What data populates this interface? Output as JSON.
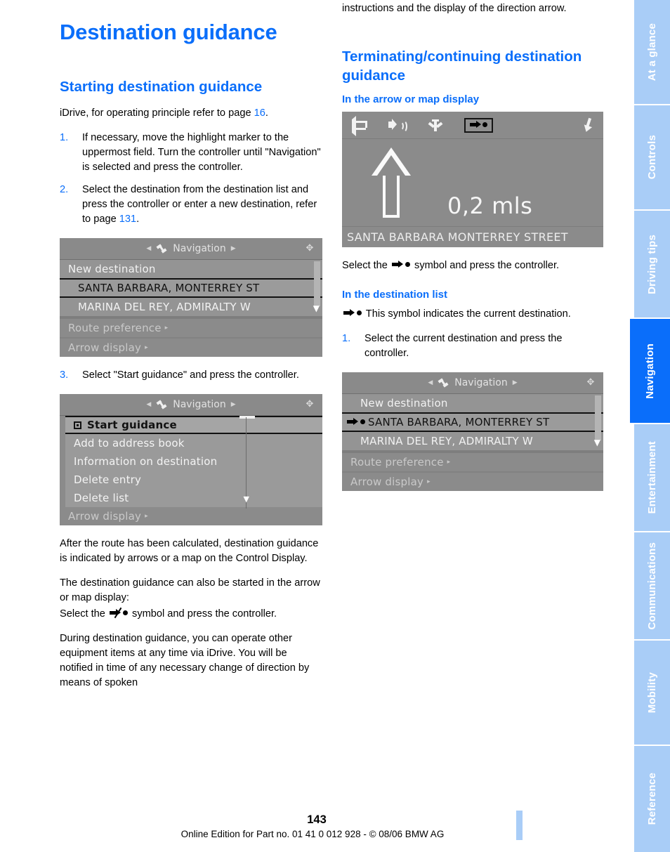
{
  "document": {
    "title": "Destination guidance",
    "page_number": "143",
    "footer_line": "Online Edition for Part no. 01 41 0 012 928 - © 08/06 BMW AG",
    "accent_color": "#0a6efa",
    "tab_inactive_color": "#a9cdf7"
  },
  "sidebar": {
    "tabs": [
      {
        "label": "At a glance",
        "active": false
      },
      {
        "label": "Controls",
        "active": false
      },
      {
        "label": "Driving tips",
        "active": false
      },
      {
        "label": "Navigation",
        "active": true
      },
      {
        "label": "Entertainment",
        "active": false
      },
      {
        "label": "Communications",
        "active": false
      },
      {
        "label": "Mobility",
        "active": false
      },
      {
        "label": "Reference",
        "active": false
      }
    ]
  },
  "left_column": {
    "section_title": "Starting destination guidance",
    "intro_pre": "iDrive, for operating principle refer to page ",
    "intro_ref": "16",
    "intro_post": ".",
    "steps": [
      {
        "num": "1.",
        "text": "If necessary, move the highlight marker to the uppermost field. Turn the controller until \"Navigation\" is selected and press the controller."
      },
      {
        "num": "2.",
        "text_pre": "Select the destination from the destination list and press the controller or enter a new destination, refer to page ",
        "text_ref": "131",
        "text_post": "."
      }
    ],
    "step3": {
      "num": "3.",
      "text": "Select \"Start guidance\" and press the controller."
    },
    "paragraph_after_route": "After the route has been calculated, destination guidance is indicated by arrows or a map on the Control Display.",
    "paragraph_also_started": "The destination guidance can also be started in the arrow or map display:",
    "select_symbol_pre": "Select the ",
    "select_symbol_post": " symbol and press the controller.",
    "paragraph_during_1": "During destination guidance, you can operate other equipment items at any time via iDrive. You will be notified in time of any necessary change of direction by means of spoken"
  },
  "right_column": {
    "continuation_text": "instructions and the display of the direction arrow.",
    "section_title": "Terminating/continuing destination guidance",
    "sub_title_arrow": "In the arrow or map display",
    "select_symbol_pre": "Select the ",
    "select_symbol_post": " symbol and press the controller.",
    "sub_title_list": "In the destination list",
    "symbol_note_post": " This symbol indicates the current destination.",
    "step1": {
      "num": "1.",
      "text": "Select the current destination and press the controller."
    }
  },
  "screenshots": {
    "nav_list": {
      "header_title": "Navigation",
      "rows": [
        {
          "label": "New destination",
          "style": "lighter"
        },
        {
          "label": "SANTA BARBARA, MONTERREY ST",
          "style": "sel"
        },
        {
          "label": "MARINA DEL REY, ADMIRALTY W",
          "style": "lighter"
        }
      ],
      "footer_rows": [
        {
          "label": "Route preference",
          "chevron": "▸"
        },
        {
          "label": "Arrow display",
          "chevron": "▸"
        }
      ]
    },
    "nav_menu": {
      "header_title": "Navigation",
      "rows": [
        {
          "label": "Start guidance",
          "style": "menu-sel",
          "checkbox": true
        },
        {
          "label": "Add to address book",
          "style": "menu"
        },
        {
          "label": "Information on destination",
          "style": "menu"
        },
        {
          "label": "Delete entry",
          "style": "menu"
        },
        {
          "label": "Delete list",
          "style": "menu"
        }
      ],
      "footer_rows": [
        {
          "label": "Arrow display",
          "chevron": "▸"
        }
      ]
    },
    "arrow_display": {
      "toolbar_icons": [
        "back-icon",
        "volume-icon",
        "highway-icon",
        "destination-guidance-icon",
        "exit-icon"
      ],
      "distance": "0,2 mls",
      "street": "SANTA BARBARA MONTERREY STREET"
    },
    "nav_list_current": {
      "header_title": "Navigation",
      "rows": [
        {
          "label": "New destination",
          "style": "lighter"
        },
        {
          "label": "SANTA BARBARA, MONTERREY ST",
          "style": "sel",
          "symbol": true
        },
        {
          "label": "MARINA DEL REY, ADMIRALTY W",
          "style": "lighter"
        }
      ],
      "footer_rows": [
        {
          "label": "Route preference",
          "chevron": "▸"
        },
        {
          "label": "Arrow display",
          "chevron": "▸"
        }
      ]
    }
  }
}
